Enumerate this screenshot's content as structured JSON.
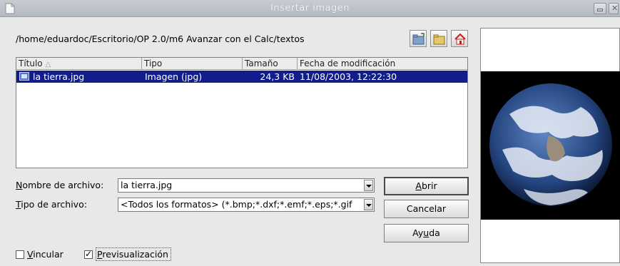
{
  "window": {
    "title": "Insertar imagen"
  },
  "path": "/home/eduardoc/Escritorio/OP 2.0/m6 Avanzar con el Calc/textos",
  "toolbar": {
    "icons": [
      "new-folder-icon",
      "up-folder-icon",
      "home-icon"
    ]
  },
  "filelist": {
    "columns": [
      "Título",
      "Tipo",
      "Tamaño",
      "Fecha de modificación"
    ],
    "rows": [
      {
        "name": "la tierra.jpg",
        "type": "Imagen (jpg)",
        "size": "24,3 KB",
        "date": "11/08/2003, 12:22:30",
        "selected": true
      }
    ]
  },
  "form": {
    "filename_label": "Nombre de archivo:",
    "filename_value": "la tierra.jpg",
    "filetype_label": "Tipo de archivo:",
    "filetype_value": "<Todos los formatos> (*.bmp;*.dxf;*.emf;*.eps;*.gif"
  },
  "buttons": {
    "open": "Abrir",
    "cancel": "Cancelar",
    "help": "Ayuda"
  },
  "options": {
    "link": {
      "label": "Vincular",
      "checked": false
    },
    "preview": {
      "label": "Previsualización",
      "checked": true
    }
  },
  "colors": {
    "selection": "#101d8a",
    "titlebar": "#c9ccd3"
  }
}
